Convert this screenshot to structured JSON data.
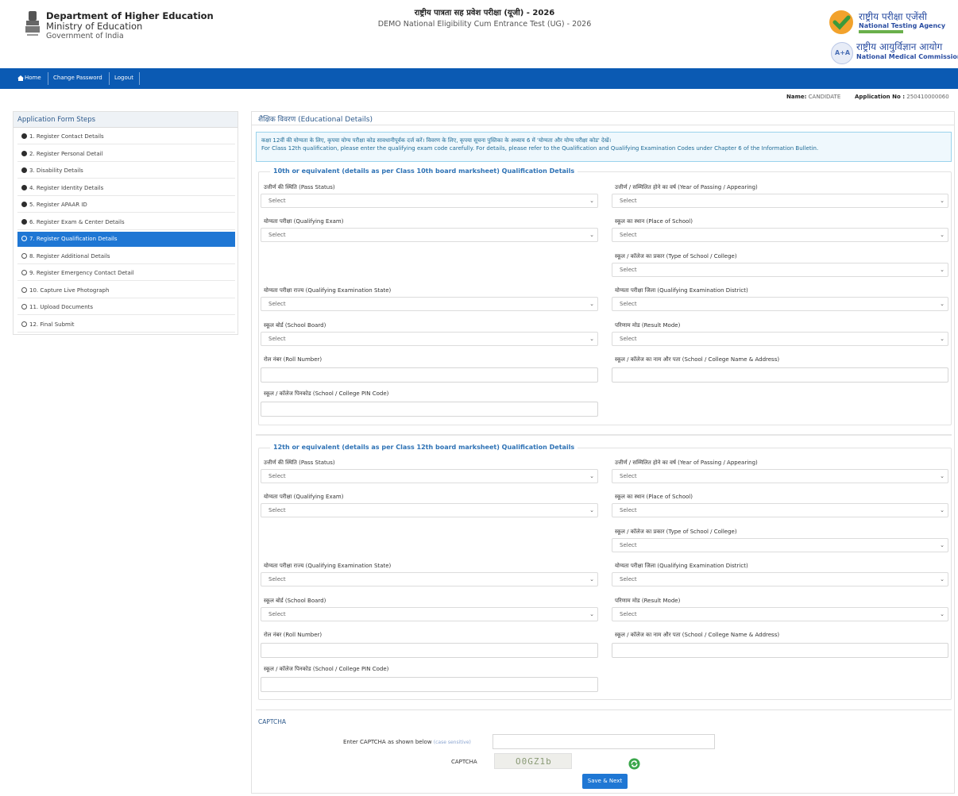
{
  "header": {
    "dept_line1": "Department of Higher Education",
    "dept_line2": "Ministry of Education",
    "dept_line3": "Government of India",
    "title_hi": "राष्ट्रीय पात्रता सह प्रवेश परीक्षा (यूजी) - 2026",
    "title_en": "DEMO National Eligibility Cum Entrance Test (UG) - 2026",
    "nta_hi": "राष्ट्रीय परीक्षा एजेंसी",
    "nta_en": "National Testing Agency",
    "nmc_hi": "राष्ट्रीय आयुर्विज्ञान आयोग",
    "nmc_en": "National Medical Commission",
    "nmc_logo_text": "A+A"
  },
  "nav": {
    "home": "Home",
    "change_password": "Change Password",
    "logout": "Logout"
  },
  "user": {
    "name_label": "Name:",
    "name_value": "CANDIDATE",
    "app_label": "Application No :",
    "app_value": "250410000060"
  },
  "sidebar": {
    "title": "Application Form Steps",
    "steps": [
      {
        "label": "1. Register Contact Details",
        "done": true
      },
      {
        "label": "2. Register Personal Detail",
        "done": true
      },
      {
        "label": "3. Disability Details",
        "done": true
      },
      {
        "label": "4. Register Identity Details",
        "done": true
      },
      {
        "label": "5. Register APAAR ID",
        "done": true
      },
      {
        "label": "6. Register Exam & Center Details",
        "done": true
      },
      {
        "label": "7. Register Qualification Details",
        "done": false,
        "active": true
      },
      {
        "label": "8. Register Additional Details",
        "done": false
      },
      {
        "label": "9. Register Emergency Contact Detail",
        "done": false
      },
      {
        "label": "10. Capture Live Photograph",
        "done": false
      },
      {
        "label": "11. Upload Documents",
        "done": false
      },
      {
        "label": "12. Final Submit",
        "done": false
      }
    ]
  },
  "main": {
    "title": "शैक्षिक विवरण (Educational Details)",
    "note_hi": "कक्षा 12वीं की योग्यता के लिए, कृपया योग्य परीक्षा कोड सावधानीपूर्वक दर्ज करें। विवरण के लिए, कृपया सूचना पुस्तिका के अध्याय 6 में 'योग्यता और योग्य परीक्षा कोड' देखें।",
    "note_en": "For Class 12th qualification, please enter the qualifying exam code carefully. For details, please refer to the Qualification and Qualifying Examination Codes under Chapter 6 of the Information Bulletin.",
    "section10_legend": "10th or equivalent (details as per Class 10th board marksheet) Qualification Details",
    "section12_legend": "12th or equivalent (details as per Class 12th board marksheet) Qualification Details"
  },
  "fields": {
    "pass_status": "उत्तीर्ण की स्थिति (Pass Status)",
    "year_passing": "उत्तीर्ण / सम्मिलित होने का वर्ष (Year of Passing / Appearing)",
    "qualifying_exam": "योग्यता परीक्षा (Qualifying Exam)",
    "place_school": "स्कूल का स्थान (Place of School)",
    "type_school": "स्कूल / कॉलेज का प्रकार (Type of School / College)",
    "qual_state": "योग्यता परीक्षा राज्य (Qualifying Examination State)",
    "qual_district": "योग्यता परीक्षा जिला (Qualifying Examination District)",
    "school_board": "स्कूल बोर्ड (School Board)",
    "result_mode": "परिणाम मोड (Result Mode)",
    "roll_number": "रोल नंबर (Roll Number)",
    "school_name": "स्कूल / कॉलेज का नाम और पता (School / College Name & Address)",
    "school_pin": "स्कूल / कॉलेज पिनकोड (School / College PIN Code)",
    "select_placeholder": "Select"
  },
  "captcha": {
    "title": "CAPTCHA",
    "enter_label": "Enter CAPTCHA as shown below",
    "case_note": "(case sensitive)",
    "label": "CAPTCHA",
    "code": "O0GZ1b",
    "save_next": "Save & Next"
  },
  "colors": {
    "navbar": "#0b5ab3",
    "active_step": "#1f77d4",
    "legend": "#2e72b5",
    "note_bg": "#eff8fd",
    "note_border": "#9ad3ec"
  }
}
